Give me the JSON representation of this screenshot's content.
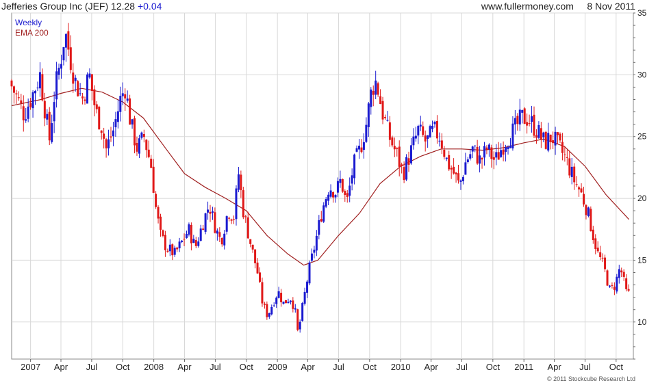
{
  "header": {
    "name": "Jefferies Group Inc (JEF)",
    "price": "12.28",
    "change": "+0.04",
    "site": "www.fullermoney.com",
    "date": "8 Nov 2011"
  },
  "footer": {
    "copyright": "© 2011 Stockcube Research Ltd"
  },
  "colors": {
    "up": "#1a1ad0",
    "down": "#e01818",
    "ema": "#a02020",
    "grid": "#d8d8d8"
  },
  "chart_data": {
    "type": "candlestick",
    "title": "Jefferies Group Inc (JEF) 12.28 +0.04",
    "ylim": [
      7,
      35
    ],
    "y_ticks": [
      10,
      15,
      20,
      25,
      30,
      35
    ],
    "x_range": [
      "2006-11-06",
      "2011-11-21"
    ],
    "x_ticks": [
      {
        "date": "2007-01-01",
        "label": "2007"
      },
      {
        "date": "2007-04-01",
        "label": "Apr"
      },
      {
        "date": "2007-07-01",
        "label": "Jul"
      },
      {
        "date": "2007-10-01",
        "label": "Oct"
      },
      {
        "date": "2008-01-01",
        "label": "2008"
      },
      {
        "date": "2008-04-01",
        "label": "Apr"
      },
      {
        "date": "2008-07-01",
        "label": "Jul"
      },
      {
        "date": "2008-10-01",
        "label": "Oct"
      },
      {
        "date": "2009-01-01",
        "label": "2009"
      },
      {
        "date": "2009-04-01",
        "label": "Apr"
      },
      {
        "date": "2009-07-01",
        "label": "Jul"
      },
      {
        "date": "2009-10-01",
        "label": "Oct"
      },
      {
        "date": "2010-01-01",
        "label": "2010"
      },
      {
        "date": "2010-04-01",
        "label": "Apr"
      },
      {
        "date": "2010-07-01",
        "label": "Jul"
      },
      {
        "date": "2010-10-01",
        "label": "Oct"
      },
      {
        "date": "2011-01-01",
        "label": "2011"
      },
      {
        "date": "2011-04-01",
        "label": "Apr"
      },
      {
        "date": "2011-07-01",
        "label": "Jul"
      },
      {
        "date": "2011-10-01",
        "label": "Oct"
      }
    ],
    "series": [
      {
        "name": "Weekly",
        "kind": "candlestick"
      },
      {
        "name": "EMA 200",
        "kind": "line"
      }
    ],
    "price_path": [
      [
        "2006-11-06",
        29.5
      ],
      [
        "2006-12-01",
        28.0
      ],
      [
        "2006-12-20",
        26.8
      ],
      [
        "2007-01-15",
        28.5
      ],
      [
        "2007-02-05",
        30.0
      ],
      [
        "2007-02-26",
        26.0
      ],
      [
        "2007-03-05",
        24.8
      ],
      [
        "2007-03-20",
        28.5
      ],
      [
        "2007-04-09",
        31.5
      ],
      [
        "2007-04-20",
        33.5
      ],
      [
        "2007-05-01",
        32.0
      ],
      [
        "2007-05-20",
        29.5
      ],
      [
        "2007-06-10",
        28.0
      ],
      [
        "2007-07-01",
        30.0
      ],
      [
        "2007-07-20",
        27.0
      ],
      [
        "2007-08-05",
        26.0
      ],
      [
        "2007-08-20",
        24.0
      ],
      [
        "2007-09-10",
        25.5
      ],
      [
        "2007-10-01",
        28.0
      ],
      [
        "2007-10-15",
        29.0
      ],
      [
        "2007-11-01",
        26.0
      ],
      [
        "2007-11-20",
        24.0
      ],
      [
        "2007-12-10",
        25.0
      ],
      [
        "2008-01-01",
        22.5
      ],
      [
        "2008-01-15",
        19.0
      ],
      [
        "2008-01-28",
        17.0
      ],
      [
        "2008-02-15",
        16.0
      ],
      [
        "2008-03-10",
        15.5
      ],
      [
        "2008-04-01",
        16.5
      ],
      [
        "2008-04-20",
        17.5
      ],
      [
        "2008-05-10",
        16.0
      ],
      [
        "2008-06-01",
        18.0
      ],
      [
        "2008-06-20",
        19.5
      ],
      [
        "2008-07-10",
        17.5
      ],
      [
        "2008-07-25",
        16.5
      ],
      [
        "2008-08-15",
        19.0
      ],
      [
        "2008-09-01",
        18.5
      ],
      [
        "2008-09-15",
        22.0
      ],
      [
        "2008-09-29",
        19.0
      ],
      [
        "2008-10-15",
        17.0
      ],
      [
        "2008-11-10",
        14.0
      ],
      [
        "2008-11-25",
        11.5
      ],
      [
        "2008-12-10",
        10.5
      ],
      [
        "2008-12-25",
        11.5
      ],
      [
        "2009-01-10",
        12.5
      ],
      [
        "2009-01-25",
        11.5
      ],
      [
        "2009-02-15",
        12.0
      ],
      [
        "2009-03-01",
        11.0
      ],
      [
        "2009-03-10",
        9.0
      ],
      [
        "2009-03-25",
        11.5
      ],
      [
        "2009-04-10",
        14.0
      ],
      [
        "2009-05-01",
        16.5
      ],
      [
        "2009-05-20",
        19.0
      ],
      [
        "2009-06-10",
        21.0
      ],
      [
        "2009-06-30",
        20.5
      ],
      [
        "2009-07-15",
        21.5
      ],
      [
        "2009-08-01",
        19.5
      ],
      [
        "2009-08-20",
        22.5
      ],
      [
        "2009-09-10",
        24.0
      ],
      [
        "2009-09-28",
        26.0
      ],
      [
        "2009-10-15",
        29.0
      ],
      [
        "2009-10-28",
        29.5
      ],
      [
        "2009-11-15",
        27.0
      ],
      [
        "2009-12-05",
        25.0
      ],
      [
        "2009-12-28",
        23.5
      ],
      [
        "2010-01-15",
        22.0
      ],
      [
        "2010-02-10",
        24.0
      ],
      [
        "2010-03-01",
        25.5
      ],
      [
        "2010-03-25",
        24.5
      ],
      [
        "2010-04-15",
        25.5
      ],
      [
        "2010-05-05",
        25.0
      ],
      [
        "2010-05-25",
        23.0
      ],
      [
        "2010-06-15",
        22.0
      ],
      [
        "2010-07-01",
        21.0
      ],
      [
        "2010-07-20",
        23.0
      ],
      [
        "2010-08-10",
        24.0
      ],
      [
        "2010-09-01",
        23.0
      ],
      [
        "2010-09-20",
        24.0
      ],
      [
        "2010-10-15",
        23.0
      ],
      [
        "2010-11-10",
        24.5
      ],
      [
        "2010-12-10",
        25.5
      ],
      [
        "2011-01-01",
        26.5
      ],
      [
        "2011-01-20",
        26.5
      ],
      [
        "2011-02-15",
        25.5
      ],
      [
        "2011-03-10",
        24.5
      ],
      [
        "2011-04-01",
        25.0
      ],
      [
        "2011-04-25",
        24.0
      ],
      [
        "2011-05-15",
        23.0
      ],
      [
        "2011-06-05",
        21.5
      ],
      [
        "2011-06-25",
        20.5
      ],
      [
        "2011-07-15",
        19.0
      ],
      [
        "2011-08-01",
        17.0
      ],
      [
        "2011-08-15",
        15.5
      ],
      [
        "2011-09-01",
        14.5
      ],
      [
        "2011-09-20",
        12.5
      ],
      [
        "2011-10-05",
        13.0
      ],
      [
        "2011-10-20",
        14.5
      ],
      [
        "2011-11-08",
        12.28
      ]
    ],
    "ema_200": [
      [
        "2006-11-06",
        27.5
      ],
      [
        "2007-02-01",
        28.0
      ],
      [
        "2007-04-01",
        28.5
      ],
      [
        "2007-06-01",
        28.9
      ],
      [
        "2007-08-01",
        28.6
      ],
      [
        "2007-10-01",
        27.8
      ],
      [
        "2007-12-01",
        26.5
      ],
      [
        "2008-02-01",
        24.2
      ],
      [
        "2008-04-01",
        22.0
      ],
      [
        "2008-06-01",
        20.9
      ],
      [
        "2008-08-01",
        20.0
      ],
      [
        "2008-10-01",
        19.0
      ],
      [
        "2008-12-01",
        17.0
      ],
      [
        "2009-02-01",
        15.5
      ],
      [
        "2009-03-20",
        14.6
      ],
      [
        "2009-05-01",
        15.0
      ],
      [
        "2009-07-01",
        17.0
      ],
      [
        "2009-09-01",
        18.8
      ],
      [
        "2009-11-01",
        21.2
      ],
      [
        "2010-01-01",
        22.6
      ],
      [
        "2010-03-01",
        23.4
      ],
      [
        "2010-05-01",
        24.0
      ],
      [
        "2010-07-01",
        24.0
      ],
      [
        "2010-09-01",
        23.9
      ],
      [
        "2010-11-01",
        24.1
      ],
      [
        "2011-01-01",
        24.5
      ],
      [
        "2011-03-01",
        24.8
      ],
      [
        "2011-05-01",
        24.2
      ],
      [
        "2011-07-01",
        22.6
      ],
      [
        "2011-09-01",
        20.3
      ],
      [
        "2011-11-08",
        18.3
      ]
    ]
  }
}
